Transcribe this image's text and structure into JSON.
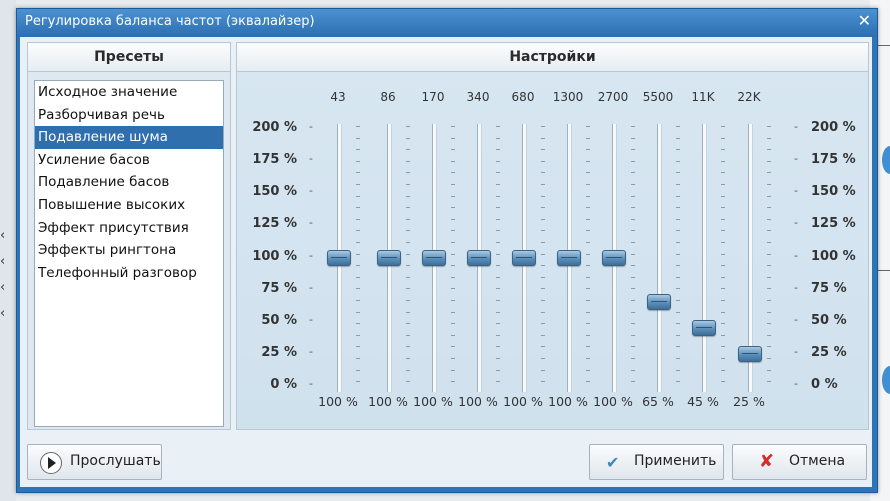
{
  "window": {
    "title": "Регулировка баланса частот (эквалайзер)",
    "close_icon": "close-icon"
  },
  "presets": {
    "title": "Пресеты",
    "items": [
      {
        "label": "Исходное значение",
        "selected": false
      },
      {
        "label": "Разборчивая речь",
        "selected": false
      },
      {
        "label": "Подавление шума",
        "selected": true
      },
      {
        "label": "Усиление басов",
        "selected": false
      },
      {
        "label": "Подавление басов",
        "selected": false
      },
      {
        "label": "Повышение высоких",
        "selected": false
      },
      {
        "label": "Эффект присутствия",
        "selected": false
      },
      {
        "label": "Эффекты рингтона",
        "selected": false
      },
      {
        "label": "Телефонный разговор",
        "selected": false
      }
    ]
  },
  "settings": {
    "title": "Настройки",
    "scale": [
      "200 %",
      "175 %",
      "150 %",
      "125 %",
      "100 %",
      "75 %",
      "50 %",
      "25 %",
      "0 %"
    ],
    "bands": [
      {
        "freq": "43",
        "value": 100,
        "value_label": "100 %"
      },
      {
        "freq": "86",
        "value": 100,
        "value_label": "100 %"
      },
      {
        "freq": "170",
        "value": 100,
        "value_label": "100 %"
      },
      {
        "freq": "340",
        "value": 100,
        "value_label": "100 %"
      },
      {
        "freq": "680",
        "value": 100,
        "value_label": "100 %"
      },
      {
        "freq": "1300",
        "value": 100,
        "value_label": "100 %"
      },
      {
        "freq": "2700",
        "value": 100,
        "value_label": "100 %"
      },
      {
        "freq": "5500",
        "value": 65,
        "value_label": "65 %"
      },
      {
        "freq": "11K",
        "value": 45,
        "value_label": "45 %"
      },
      {
        "freq": "22K",
        "value": 25,
        "value_label": "25 %"
      }
    ]
  },
  "buttons": {
    "play": {
      "label": "Прослушать",
      "icon": "play-icon"
    },
    "apply": {
      "label": "Применить",
      "icon": "check-icon"
    },
    "cancel": {
      "label": "Отмена",
      "icon": "cancel-x-icon"
    }
  }
}
